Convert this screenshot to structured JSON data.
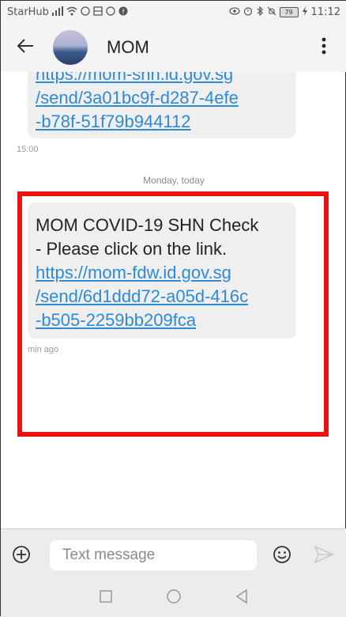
{
  "status_bar": {
    "carrier": "StarHub",
    "battery": "79",
    "time": "11:12"
  },
  "header": {
    "contact_name": "MOM"
  },
  "messages": {
    "previous": {
      "lines": [
        "https://mom-shn.id.gov.sg",
        "/send/3a01bc9f-d287-4efe",
        "-b78f-51f79b944112"
      ],
      "timestamp": "15:00"
    },
    "date_separator": "Monday, today",
    "latest": {
      "text_lines": [
        "MOM COVID-19 SHN Check",
        "- Please click on the link."
      ],
      "link_lines": [
        "https://mom-fdw.id.gov.sg",
        "/send/6d1ddd72-a05d-416c",
        "-b505-2259bb209fca"
      ],
      "timestamp": "min ago"
    }
  },
  "composer": {
    "placeholder": "Text message"
  },
  "colors": {
    "highlight": "#ee1111",
    "link": "#2e8ad8",
    "bubble": "#efefef"
  }
}
